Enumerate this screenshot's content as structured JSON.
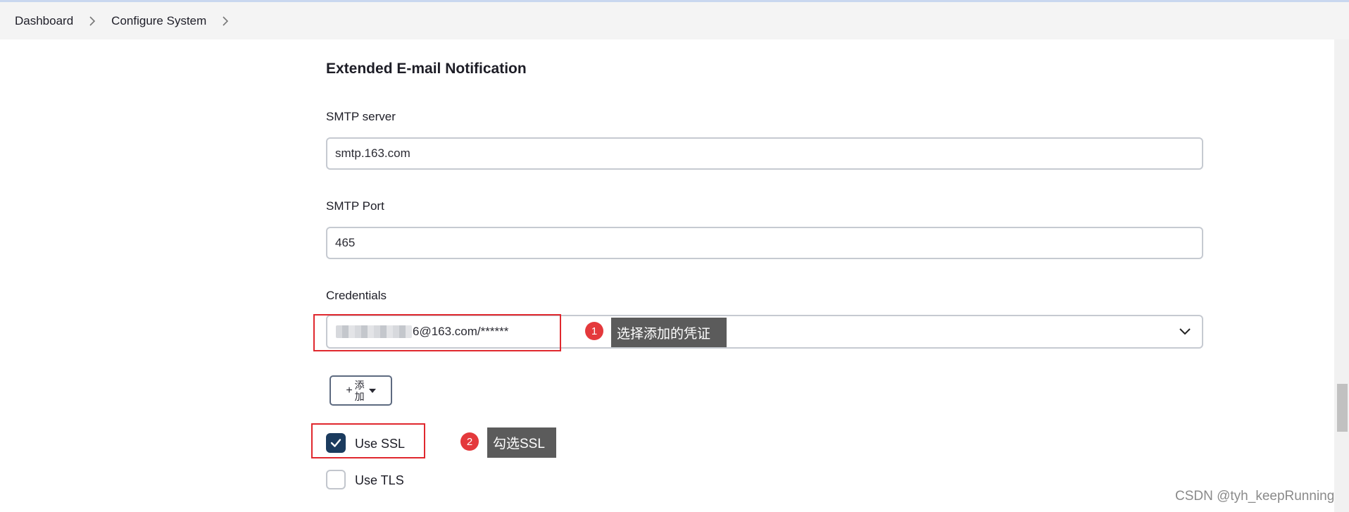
{
  "breadcrumb": {
    "items": [
      "Dashboard",
      "Configure System"
    ]
  },
  "section": {
    "title": "Extended E-mail Notification"
  },
  "smtp_server": {
    "label": "SMTP server",
    "value": "smtp.163.com"
  },
  "smtp_port": {
    "label": "SMTP Port",
    "value": "465"
  },
  "credentials": {
    "label": "Credentials",
    "selected_value": "6@163.com/******"
  },
  "annotations": [
    {
      "number": "1",
      "text": "选择添加的凭证"
    },
    {
      "number": "2",
      "text": "勾选SSL"
    }
  ],
  "add_button": {
    "plus": "+",
    "label": "添加"
  },
  "options": {
    "use_ssl": {
      "label": "Use SSL",
      "checked": true
    },
    "use_tls": {
      "label": "Use TLS",
      "checked": false
    }
  },
  "watermark": "CSDN @tyh_keepRunning",
  "colors": {
    "checkbox_checked": "#1b3b5e",
    "annotation_red": "#e0282e",
    "tooltip_bg": "#5b5b5b"
  },
  "icons": {
    "breadcrumb_separator": "chevron-right-icon",
    "dropdown": "chevron-down-icon",
    "checkmark": "check-icon"
  }
}
